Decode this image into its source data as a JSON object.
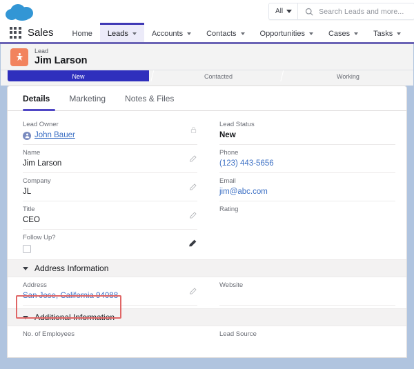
{
  "global_header": {
    "logo": "salesforce-cloud-logo",
    "search": {
      "scope_label": "All",
      "placeholder": "Search Leads and more...",
      "icon": "search-icon"
    }
  },
  "nav": {
    "app_launcher_icon": "app-launcher-waffle-icon",
    "app_name": "Sales",
    "items": [
      {
        "label": "Home",
        "has_menu": false,
        "active": false
      },
      {
        "label": "Leads",
        "has_menu": true,
        "active": true
      },
      {
        "label": "Accounts",
        "has_menu": true,
        "active": false
      },
      {
        "label": "Contacts",
        "has_menu": true,
        "active": false
      },
      {
        "label": "Opportunities",
        "has_menu": true,
        "active": false
      },
      {
        "label": "Cases",
        "has_menu": true,
        "active": false
      },
      {
        "label": "Tasks",
        "has_menu": true,
        "active": false
      }
    ]
  },
  "record_header": {
    "object_type": "Lead",
    "record_name": "Jim Larson",
    "avatar_icon": "lead-star-icon"
  },
  "path": {
    "steps": [
      {
        "label": "New",
        "state": "current"
      },
      {
        "label": "Contacted",
        "state": "upcoming"
      },
      {
        "label": "Working",
        "state": "upcoming"
      }
    ]
  },
  "tabs": [
    {
      "label": "Details",
      "active": true
    },
    {
      "label": "Marketing",
      "active": false
    },
    {
      "label": "Notes & Files",
      "active": false
    }
  ],
  "details": {
    "left_fields": [
      {
        "label": "Lead Owner",
        "value": "John Bauer",
        "style": "link-underline",
        "action": "lock-icon",
        "avatar": true
      },
      {
        "label": "Name",
        "value": "Jim Larson",
        "style": "text",
        "action": "pencil-icon"
      },
      {
        "label": "Company",
        "value": "JL",
        "style": "text",
        "action": "pencil-icon"
      },
      {
        "label": "Title",
        "value": "CEO",
        "style": "text",
        "action": "pencil-icon"
      },
      {
        "label": "Follow Up?",
        "value": "",
        "style": "checkbox",
        "action": "pencil-icon-dark"
      }
    ],
    "right_fields": [
      {
        "label": "Lead Status",
        "value": "New",
        "style": "text"
      },
      {
        "label": "Phone",
        "value": "(123) 443-5656",
        "style": "link"
      },
      {
        "label": "Email",
        "value": "jim@abc.com",
        "style": "link"
      },
      {
        "label": "Rating",
        "value": "",
        "style": "text"
      }
    ]
  },
  "address_section": {
    "title": "Address Information",
    "left_fields": [
      {
        "label": "Address",
        "value": "San Jose, California 94088",
        "style": "link",
        "action": "pencil-icon",
        "highlighted": true
      }
    ],
    "right_fields": [
      {
        "label": "Website",
        "value": "",
        "style": "text"
      }
    ]
  },
  "additional_section": {
    "title": "Additional Information",
    "left_fields": [
      {
        "label": "No. of Employees",
        "value": "",
        "style": "text"
      }
    ],
    "right_fields": [
      {
        "label": "Lead Source",
        "value": "",
        "style": "text"
      }
    ]
  },
  "annotation": {
    "type": "red-highlight-box",
    "target": "address-field",
    "color": "#e06666"
  },
  "colors": {
    "brand_blue": "#3296d5",
    "nav_accent": "#6a63b5",
    "active_tab": "#3f38b5",
    "path_current": "#2f2fbd",
    "lead_icon": "#f2835e",
    "link": "#3b6fc4",
    "annotation": "#e06666"
  }
}
